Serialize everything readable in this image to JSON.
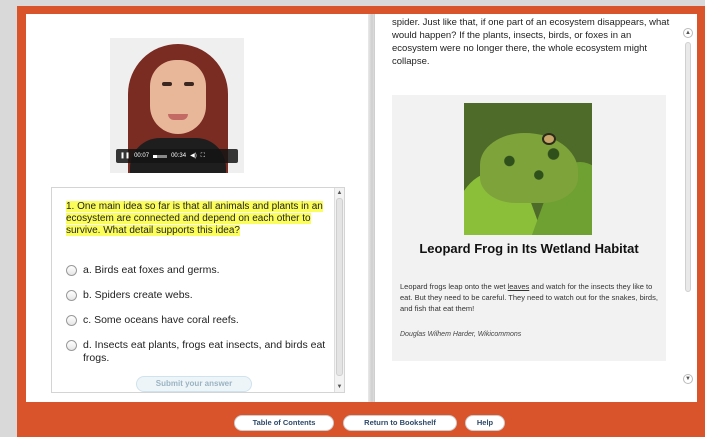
{
  "video": {
    "current_time": "00:07",
    "duration": "00:34",
    "progress_fraction": 0.2
  },
  "question": {
    "text": "1. One main idea so far is that all animals and plants in an ecosystem are connected and depend on each other to survive. What detail supports this idea?",
    "options": [
      {
        "label": "a. Birds eat foxes and germs."
      },
      {
        "label": "b. Spiders create webs."
      },
      {
        "label": "c. Some oceans have coral reefs."
      },
      {
        "label": "d. Insects eat plants, frogs eat insects, and birds eat frogs."
      }
    ],
    "submit_label": "Submit your answer"
  },
  "reading": {
    "paragraph": "spider. Just like that, if one part of an ecosystem disappears, what would happen? If the plants, insects, birds, or foxes in an ecosystem were no longer there, the whole ecosystem might collapse.",
    "figure_title": "Leopard Frog in Its Wetland Habitat",
    "caption_before": "Leopard frogs leap onto the wet ",
    "caption_link": "leaves",
    "caption_after": " and watch for the insects they like to eat. But they need to be careful. They need to watch out for the snakes, birds, and fish that eat them!",
    "credit": "Douglas Wilhem Harder, Wikicommons"
  },
  "nav": {
    "toc": "Table of Contents",
    "bookshelf": "Return to Bookshelf",
    "help": "Help"
  },
  "colors": {
    "frame": "#d9542b",
    "highlight": "#fbfd5a",
    "nav_text": "#2e4a6a"
  }
}
